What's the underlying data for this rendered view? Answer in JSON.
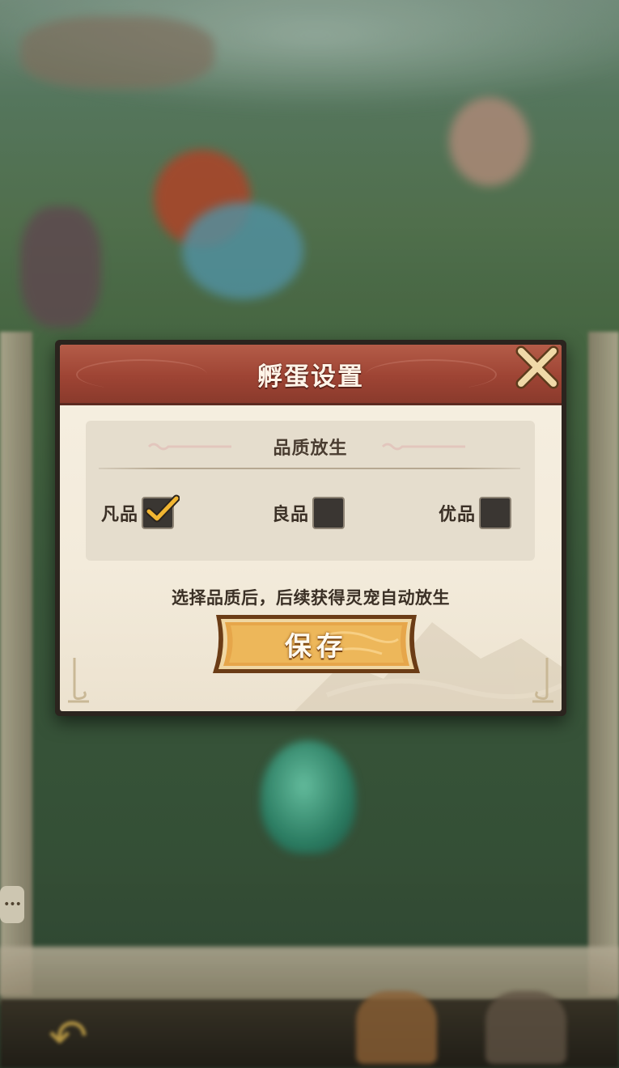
{
  "dialog": {
    "title": "孵蛋设置",
    "close_icon": "close-x-icon",
    "section_title": "品质放生",
    "options": [
      {
        "label": "凡品",
        "checked": true
      },
      {
        "label": "良品",
        "checked": false
      },
      {
        "label": "优品",
        "checked": false
      }
    ],
    "hint": "选择品质后，后续获得灵宠自动放生",
    "save_label": "保存"
  },
  "colors": {
    "title_bar": "#9e4434",
    "panel_bg": "#f3ebdb",
    "check_accent": "#f2b632",
    "save_button": "#e8a94a"
  },
  "background": {
    "chat_icon": "chat-bubble-icon",
    "back_icon": "back-arrow-icon"
  }
}
